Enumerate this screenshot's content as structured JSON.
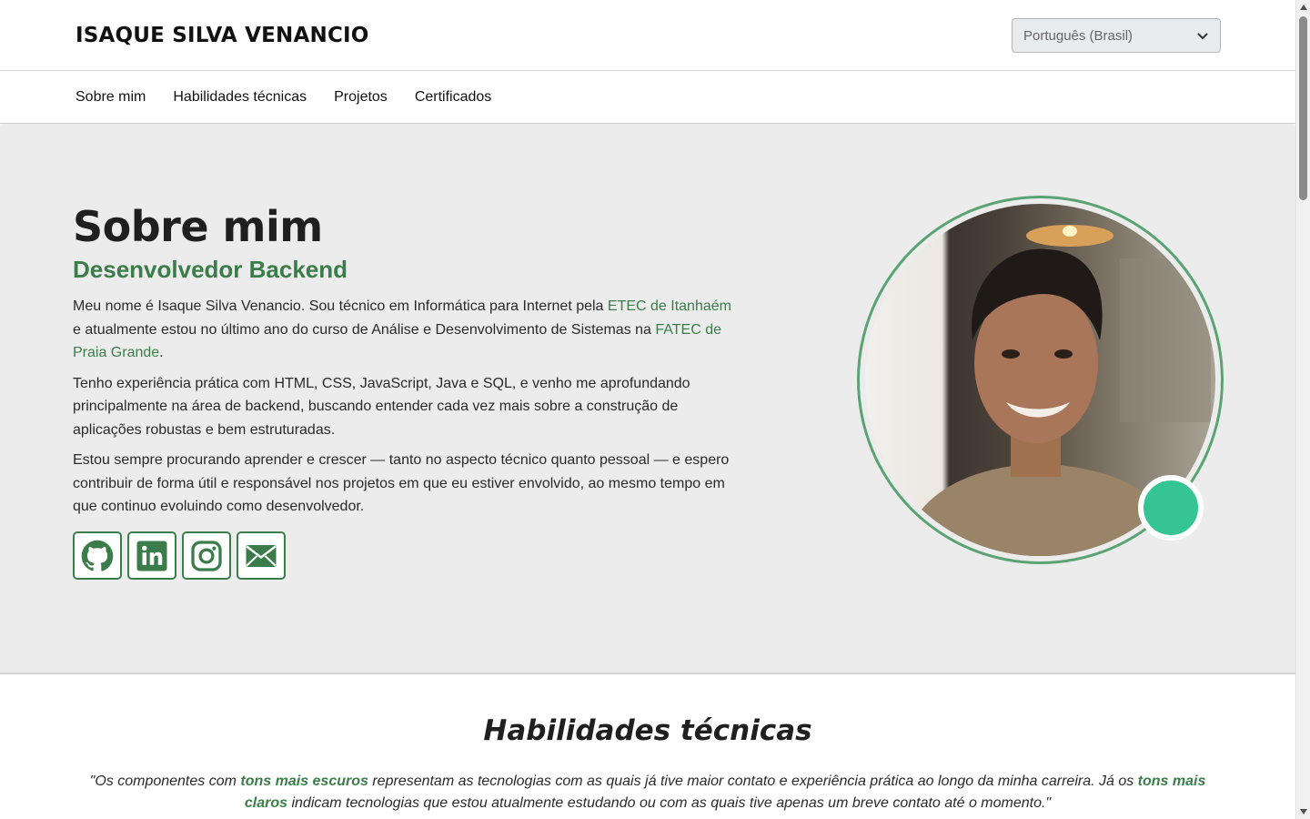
{
  "header": {
    "site_title": "ISAQUE SILVA VENANCIO",
    "language_select": {
      "value": "Português (Brasil)"
    },
    "scroll_progress": 0.2
  },
  "nav": {
    "items": [
      {
        "label": "Sobre mim"
      },
      {
        "label": "Habilidades técnicas"
      },
      {
        "label": "Projetos"
      },
      {
        "label": "Certificados"
      }
    ]
  },
  "about": {
    "title": "Sobre mim",
    "subtitle": "Desenvolvedor Backend",
    "p1": {
      "t1": "Meu nome é Isaque Silva Venancio. Sou técnico em Informática para Internet pela ",
      "link1": "ETEC de Itanhaém",
      "t2": " e atualmente estou no último ano do curso de Análise e Desenvolvimento de Sistemas na ",
      "link2": "FATEC de Praia Grande",
      "t3": "."
    },
    "p2": "Tenho experiência prática com HTML, CSS, JavaScript, Java e SQL, e venho me aprofundando principalmente na área de backend, buscando entender cada vez mais sobre a construção de aplicações robustas e bem estruturadas.",
    "p3": "Estou sempre procurando aprender e crescer — tanto no aspecto técnico quanto pessoal — e espero contribuir de forma útil e responsável nos projetos em que eu estiver envolvido, ao mesmo tempo em que continuo evoluindo como desenvolvedor.",
    "socials": [
      "github-icon",
      "linkedin-icon",
      "instagram-icon",
      "email-icon"
    ],
    "status_color": "#35c493"
  },
  "skills": {
    "title": "Habilidades técnicas",
    "quote": {
      "t1": "\"Os componentes com ",
      "b1": "tons mais escuros",
      "t2": " representam as tecnologias com as quais já tive maior contato e experiência prática ao longo da minha carreira. Já os ",
      "b2": "tons mais claros",
      "t3": " indicam tecnologias que estou atualmente estudando ou com as quais tive apenas um breve contato até o momento.\""
    }
  },
  "colors": {
    "accent": "#3b7d4a",
    "ring": "#5aa373",
    "section_bg": "#ececec"
  }
}
